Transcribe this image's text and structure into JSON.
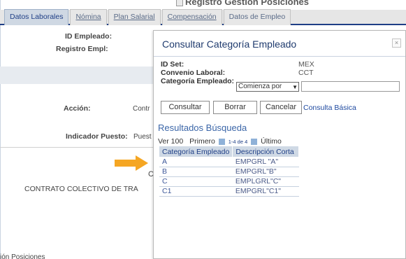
{
  "page": {
    "top_title": "Registro Gestión Posiciones",
    "tabs": [
      {
        "label": "Datos Laborales",
        "active": true,
        "underline": false
      },
      {
        "label": "Nómina",
        "active": false,
        "underline": true
      },
      {
        "label": "Plan Salarial",
        "active": false,
        "underline": true
      },
      {
        "label": "Compensación",
        "active": false,
        "underline": true
      },
      {
        "label": "Datos de Empleo",
        "active": false,
        "underline": false
      }
    ],
    "id_empleado_label": "ID Empleado:",
    "registro_label": "Registro Empl:",
    "accion_label": "Acción:",
    "accion_value": "Contr",
    "indicador_label": "Indicador Puesto:",
    "indicador_value": "Puest",
    "c_char": "C",
    "contrato_text": "CONTRATO COLECTIVO DE TRA",
    "bottom_text": "ión Posiciones"
  },
  "modal": {
    "title": "Consultar Categoría Empleado",
    "close_glyph": "×",
    "id_set_label": "ID Set:",
    "id_set_value": "MEX",
    "convenio_label": "Convenio Laboral:",
    "convenio_value": "CCT",
    "categoria_label": "Categoría Empleado:",
    "operator_selected": "Comienza por",
    "search_value": "",
    "buttons": {
      "consultar": "Consultar",
      "borrar": "Borrar",
      "cancelar": "Cancelar"
    },
    "basic_link": "Consulta Básica",
    "results": {
      "title": "Resultados Búsqueda",
      "ver": "Ver 100",
      "primero": "Primero",
      "range": "1-4 de 4",
      "ultimo": "Último",
      "headers": [
        "Categoría Empleado",
        "Descripción Corta"
      ],
      "rows": [
        [
          "A",
          "EMPGRL \"A\""
        ],
        [
          "B",
          "EMPGRL\"B\""
        ],
        [
          "C",
          "EMPLGRL\"C\""
        ],
        [
          "C1",
          "EMPGRL\"C1\""
        ]
      ]
    }
  },
  "colors": {
    "accent": "#1f3f86",
    "arrow": "#f5a623",
    "header_bg": "#cfd9e5"
  }
}
